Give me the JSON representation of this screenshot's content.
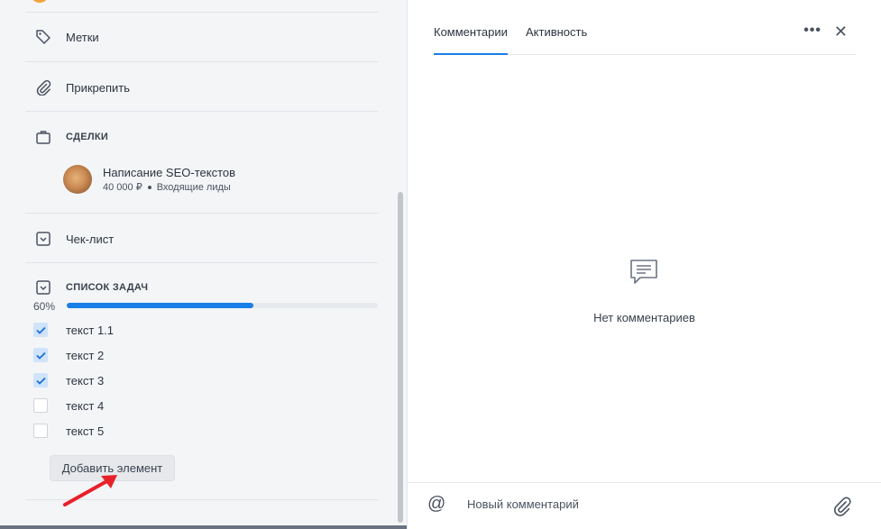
{
  "left": {
    "labels_row": "Метки",
    "attach_row": "Прикрепить",
    "deals_title": "СДЕЛКИ",
    "deal": {
      "title": "Написание SEO-текстов",
      "amount": "40 000 ₽",
      "stage": "Входящие лиды"
    },
    "checklist_row": "Чек-лист",
    "tasks_title": "СПИСОК ЗАДАЧ",
    "progress": {
      "label": "60%",
      "value": 0.6
    },
    "tasks": [
      {
        "label": "текст 1.1",
        "checked": true
      },
      {
        "label": "текст 2",
        "checked": true
      },
      {
        "label": "текст 3",
        "checked": true
      },
      {
        "label": "текст 4",
        "checked": false
      },
      {
        "label": "текст 5",
        "checked": false
      }
    ],
    "add_button": "Добавить элемент"
  },
  "right": {
    "tabs": [
      {
        "label": "Комментарии",
        "active": true
      },
      {
        "label": "Активность",
        "active": false
      }
    ],
    "empty_text": "Нет комментариев",
    "comment_placeholder": "Новый комментарий"
  },
  "colors": {
    "accent": "#1a7fe8",
    "annotation_arrow": "#e8202a"
  }
}
